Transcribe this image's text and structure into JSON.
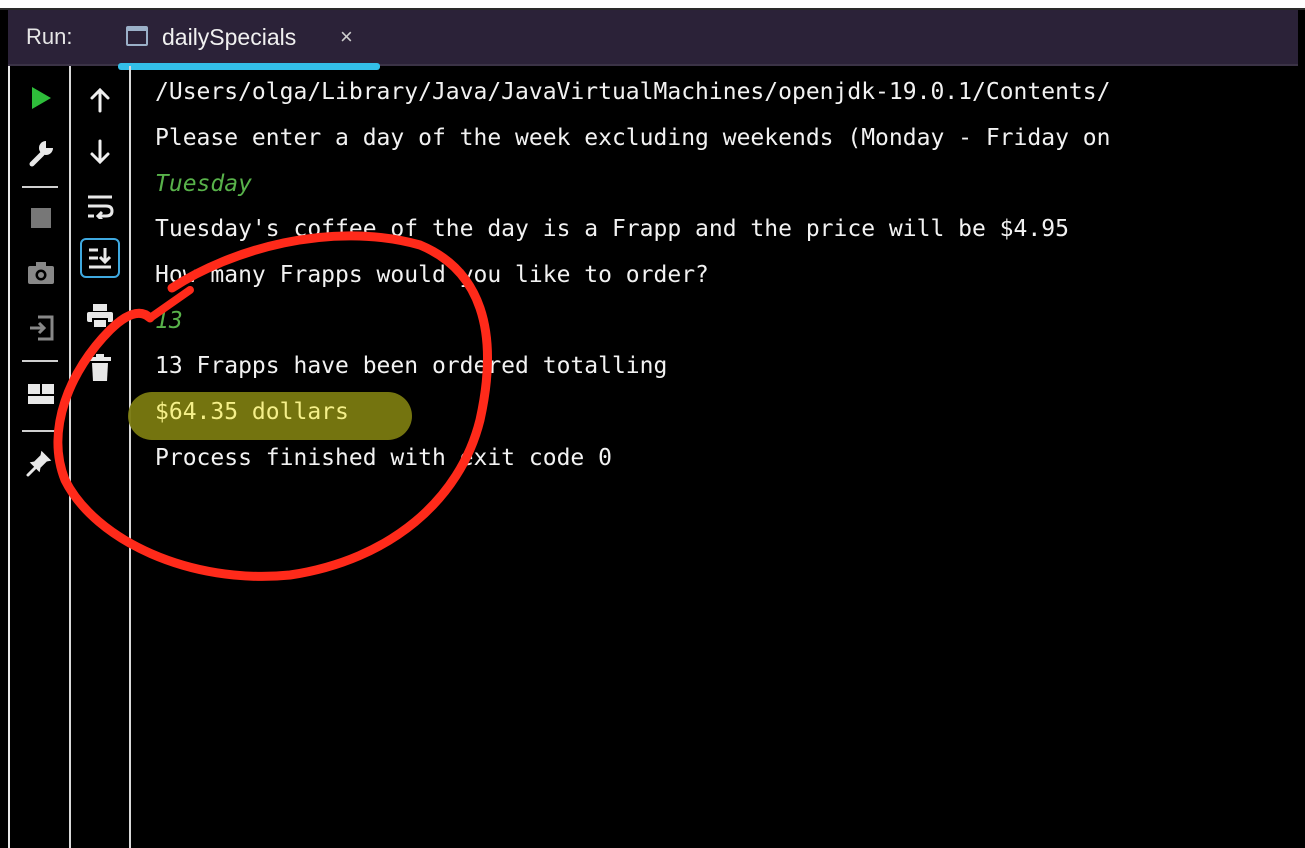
{
  "run_panel": {
    "label": "Run:",
    "tab": {
      "title": "dailySpecials",
      "close_glyph": "×",
      "icon": "console-window-icon"
    }
  },
  "toolbar_primary": [
    {
      "name": "rerun-icon",
      "glyph": "▶",
      "color": "#2ebd3a"
    },
    {
      "name": "wrench-icon",
      "glyph": "🔧"
    },
    {
      "name": "stop-icon",
      "glyph": "■",
      "color": "#777777"
    },
    {
      "name": "camera-icon",
      "glyph": "📷"
    },
    {
      "name": "exit-icon",
      "glyph": "⇥"
    },
    {
      "name": "layout-icon",
      "glyph": "▦"
    },
    {
      "name": "pin-icon",
      "glyph": "📌"
    }
  ],
  "toolbar_secondary": [
    {
      "name": "scroll-up-icon",
      "glyph": "↑"
    },
    {
      "name": "scroll-down-icon",
      "glyph": "↓"
    },
    {
      "name": "soft-wrap-icon",
      "glyph": "⤶"
    },
    {
      "name": "scroll-to-end-icon",
      "glyph": "⤓",
      "active": true
    },
    {
      "name": "print-icon",
      "glyph": "🖶"
    },
    {
      "name": "trash-icon",
      "glyph": "🗑"
    }
  ],
  "console": {
    "lines": [
      {
        "text": "/Users/olga/Library/Java/JavaVirtualMachines/openjdk-19.0.1/Contents/",
        "kind": "output"
      },
      {
        "text": "Please enter a day of the week excluding weekends (Monday - Friday on",
        "kind": "output"
      },
      {
        "text": "Tuesday",
        "kind": "input"
      },
      {
        "text": "Tuesday's coffee of the day is a Frapp and the price will be $4.95",
        "kind": "output"
      },
      {
        "text": "How many Frapps would you like to order?",
        "kind": "output"
      },
      {
        "text": "13",
        "kind": "input"
      },
      {
        "text": "13 Frapps have been ordered totalling",
        "kind": "output"
      },
      {
        "text": "$64.35 dollars",
        "kind": "highlighted"
      },
      {
        "text": "Process finished with exit code 0",
        "kind": "output"
      }
    ]
  },
  "colors": {
    "background": "#000000",
    "tab_bar": "#2b2238",
    "tab_underline": "#33bfe8",
    "input_text": "#58b24a",
    "annotation_circle": "#ff2a1a",
    "highlighter": "#7a7a10"
  }
}
